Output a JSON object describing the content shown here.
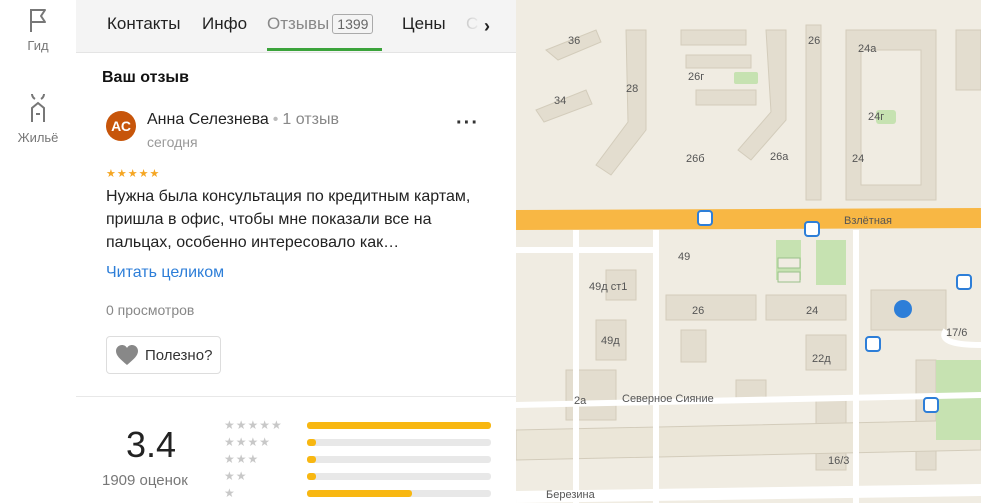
{
  "rail": {
    "guide_label": "Гид",
    "housing_label": "Жильё"
  },
  "tabs": {
    "contacts": "Контакты",
    "info": "Инфо",
    "reviews": "Отзывы",
    "reviews_count": "1399",
    "prices": "Цены",
    "next": "С"
  },
  "review": {
    "section_title": "Ваш отзыв",
    "avatar_initials": "АС",
    "author": "Анна Селезнева",
    "author_reviews": "1 отзыв",
    "date": "сегодня",
    "stars": "★★★★★",
    "text": "Нужна была консультация по кредитным картам, пришла в офис, чтобы мне показали все на пальцах, особенно интересовало как…",
    "read_more": "Читать целиком",
    "views": "0 просмотров",
    "useful": "Полезно?"
  },
  "summary": {
    "rating": "3.4",
    "count": "1909 оценок",
    "rows": [
      {
        "stars": "★★★★★",
        "fraction": 1.0
      },
      {
        "stars": "★★★★",
        "fraction": 0.05
      },
      {
        "stars": "★★★",
        "fraction": 0.05
      },
      {
        "stars": "★★",
        "fraction": 0.05
      },
      {
        "stars": "★",
        "fraction": 0.57
      }
    ]
  },
  "map": {
    "labels": [
      "36",
      "26",
      "24а",
      "26г",
      "28",
      "34",
      "24г",
      "26б",
      "26а",
      "24",
      "Взлётная",
      "49",
      "49д ст1",
      "26",
      "24",
      "49д",
      "22д",
      "2а",
      "Северное Сияние",
      "17/6",
      "16/3",
      "Березина"
    ],
    "road_color": "#f8b744",
    "building_color": "#e0dbce",
    "park_color": "#c6e2b1"
  }
}
